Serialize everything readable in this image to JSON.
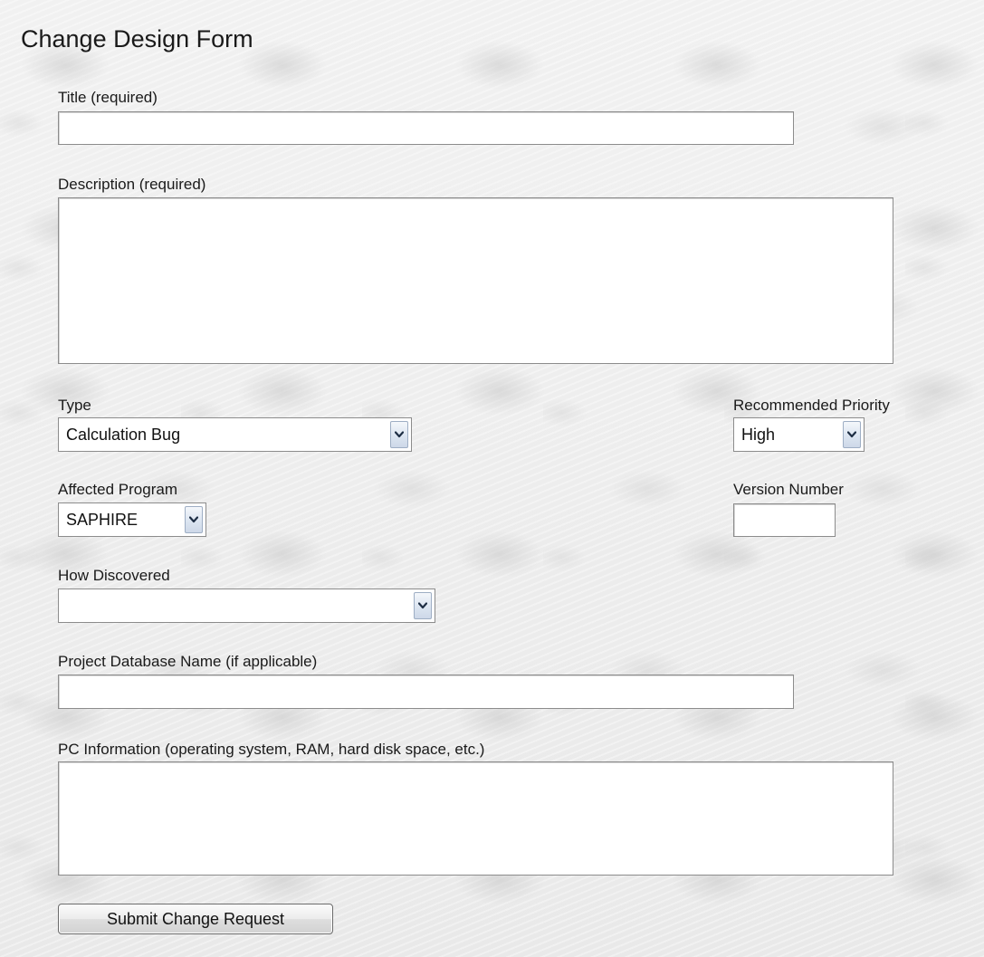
{
  "form": {
    "title": "Change Design Form",
    "fields": {
      "title": {
        "label": "Title (required)",
        "value": ""
      },
      "description": {
        "label": "Description (required)",
        "value": ""
      },
      "type": {
        "label": "Type",
        "selected": "Calculation Bug"
      },
      "recommended_priority": {
        "label": "Recommended Priority",
        "selected": "High"
      },
      "affected_program": {
        "label": "Affected Program",
        "selected": "SAPHIRE"
      },
      "version_number": {
        "label": "Version Number",
        "value": ""
      },
      "how_discovered": {
        "label": "How Discovered",
        "selected": ""
      },
      "project_database_name": {
        "label": "Project Database Name (if applicable)",
        "value": ""
      },
      "pc_information": {
        "label": "PC Information (operating system, RAM, hard disk space, etc.)",
        "value": ""
      }
    },
    "submit_label": "Submit Change Request"
  },
  "icons": {
    "dropdown": "chevron-down-icon"
  }
}
